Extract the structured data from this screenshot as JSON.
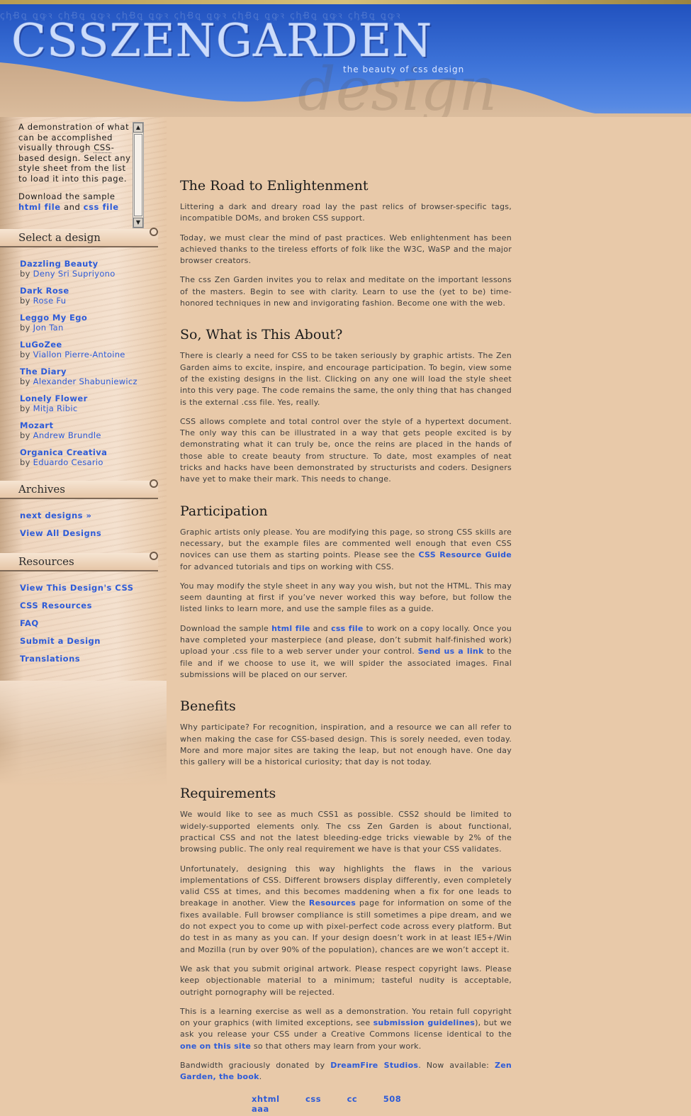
{
  "header": {
    "logo": "CSSZENGARDEN",
    "tagline": "the beauty of css design",
    "decor_script": "ꞔꞕꞖꝗ ꝗꝙꝛ ꞔꞕꞖꝗ ꝗꝙꝛ ꞔꞕꞖꝗ ꝗꝙꝛ ꞔꞕꞖꝗ ꝗꝙꝛ ꞔꞕꞖꝗ ꝗꝙꝛ ꞔꞕꞖꝗ ꝗꝙꝛ ꞔꞕꞖꝗ ꝗꝙꝛ",
    "design_word": "design"
  },
  "intro": {
    "p1_a": "A demonstration of what can be accomplished visually through ",
    "p1_css": "CSS",
    "p1_b": "-based design. Select any style sheet from the list to load it into this page.",
    "p2_a": "Download the sample ",
    "html_file": "html file",
    "and": " and ",
    "css_file": "css file"
  },
  "sidebar": {
    "select_title": "Select a design",
    "archives_title": "Archives",
    "resources_title": "Resources",
    "by": "by ",
    "designs": [
      {
        "name": "Dazzling Beauty",
        "author": "Deny Sri Supriyono"
      },
      {
        "name": "Dark Rose",
        "author": "Rose Fu"
      },
      {
        "name": "Leggo My Ego",
        "author": "Jon Tan"
      },
      {
        "name": "LuGoZee",
        "author": "Viallon Pierre-Antoine"
      },
      {
        "name": "The Diary",
        "author": "Alexander Shabuniewicz"
      },
      {
        "name": "Lonely Flower",
        "author": "Mitja Ribic"
      },
      {
        "name": "Mozart",
        "author": "Andrew Brundle"
      },
      {
        "name": "Organica Creativa",
        "author": "Eduardo Cesario"
      }
    ],
    "archives": {
      "next_designs": "next designs »",
      "view_all": "View All Designs"
    },
    "resources": {
      "view_css": "View This Design's CSS",
      "css_resources": "CSS Resources",
      "faq": "FAQ",
      "submit": "Submit a Design",
      "translations": "Translations"
    }
  },
  "main": {
    "road": {
      "title": "The Road to Enlightenment",
      "p1": "Littering a dark and dreary road lay the past relics of browser-specific tags, incompatible DOMs, and broken CSS support.",
      "p2": "Today, we must clear the mind of past practices. Web enlightenment has been achieved thanks to the tireless efforts of folk like the W3C, WaSP and the major browser creators.",
      "p3": "The css Zen Garden invites you to relax and meditate on the important lessons of the masters. Begin to see with clarity. Learn to use the (yet to be) time-honored techniques in new and invigorating fashion. Become one with the web."
    },
    "about": {
      "title": "So, What is This About?",
      "p1": "There is clearly a need for CSS to be taken seriously by graphic artists. The Zen Garden aims to excite, inspire, and encourage participation. To begin, view some of the existing designs in the list. Clicking on any one will load the style sheet into this very page. The code remains the same, the only thing that has changed is the external .css file. Yes, really.",
      "p2": "CSS allows complete and total control over the style of a hypertext document. The only way this can be illustrated in a way that gets people excited is by demonstrating what it can truly be, once the reins are placed in the hands of those able to create beauty from structure. To date, most examples of neat tricks and hacks have been demonstrated by structurists and coders. Designers have yet to make their mark. This needs to change."
    },
    "participation": {
      "title": "Participation",
      "p1_a": "Graphic artists only please. You are modifying this page, so strong CSS skills are necessary, but the example files are commented well enough that even CSS novices can use them as starting points. Please see the ",
      "p1_link": "CSS Resource Guide",
      "p1_b": " for advanced tutorials and tips on working with CSS.",
      "p2": "You may modify the style sheet in any way you wish, but not the HTML. This may seem daunting at first if you’ve never worked this way before, but follow the listed links to learn more, and use the sample files as a guide.",
      "p3_a": "Download the sample ",
      "p3_html": "html file",
      "p3_and": " and ",
      "p3_css": "css file",
      "p3_b": " to work on a copy locally. Once you have completed your masterpiece (and please, don’t submit half-finished work) upload your .css file to a web server under your control. ",
      "p3_send": "Send us a link",
      "p3_c": " to the file and if we choose to use it, we will spider the associated images. Final submissions will be placed on our server."
    },
    "benefits": {
      "title": "Benefits",
      "p1": "Why participate? For recognition, inspiration, and a resource we can all refer to when making the case for CSS-based design. This is sorely needed, even today. More and more major sites are taking the leap, but not enough have. One day this gallery will be a historical curiosity; that day is not today."
    },
    "requirements": {
      "title": "Requirements",
      "p1": "We would like to see as much CSS1 as possible. CSS2 should be limited to widely-supported elements only. The css Zen Garden is about functional, practical CSS and not the latest bleeding-edge tricks viewable by 2% of the browsing public. The only real requirement we have is that your CSS validates.",
      "p2_a": "Unfortunately, designing this way highlights the flaws in the various implementations of CSS. Different browsers display differently, even completely valid CSS at times, and this becomes maddening when a fix for one leads to breakage in another. View the ",
      "p2_link": "Resources",
      "p2_b": " page for information on some of the fixes available. Full browser compliance is still sometimes a pipe dream, and we do not expect you to come up with pixel-perfect code across every platform. But do test in as many as you can. If your design doesn’t work in at least IE5+/Win and Mozilla (run by over 90% of the population), chances are we won’t accept it.",
      "p3": "We ask that you submit original artwork. Please respect copyright laws. Please keep objectionable material to a minimum; tasteful nudity is acceptable, outright pornography will be rejected.",
      "p4_a": "This is a learning exercise as well as a demonstration. You retain full copyright on your graphics (with limited exceptions, see ",
      "p4_link": "submission guidelines",
      "p4_b": "), but we ask you release your CSS under a Creative Commons license identical to the ",
      "p4_link2": "one on this site",
      "p4_c": " so that others may learn from your work.",
      "p5_a": "Bandwidth graciously donated by ",
      "p5_link": "DreamFire Studios",
      "p5_b": ". Now available: ",
      "p5_link2": "Zen Garden, the book",
      "p5_c": "."
    }
  },
  "footer": {
    "links": [
      "xhtml",
      "css",
      "cc",
      "508",
      "aaa"
    ]
  },
  "colors": {
    "link": "#2d5bd8",
    "background": "#e8c9a9",
    "sky": "#1f4fbd"
  }
}
